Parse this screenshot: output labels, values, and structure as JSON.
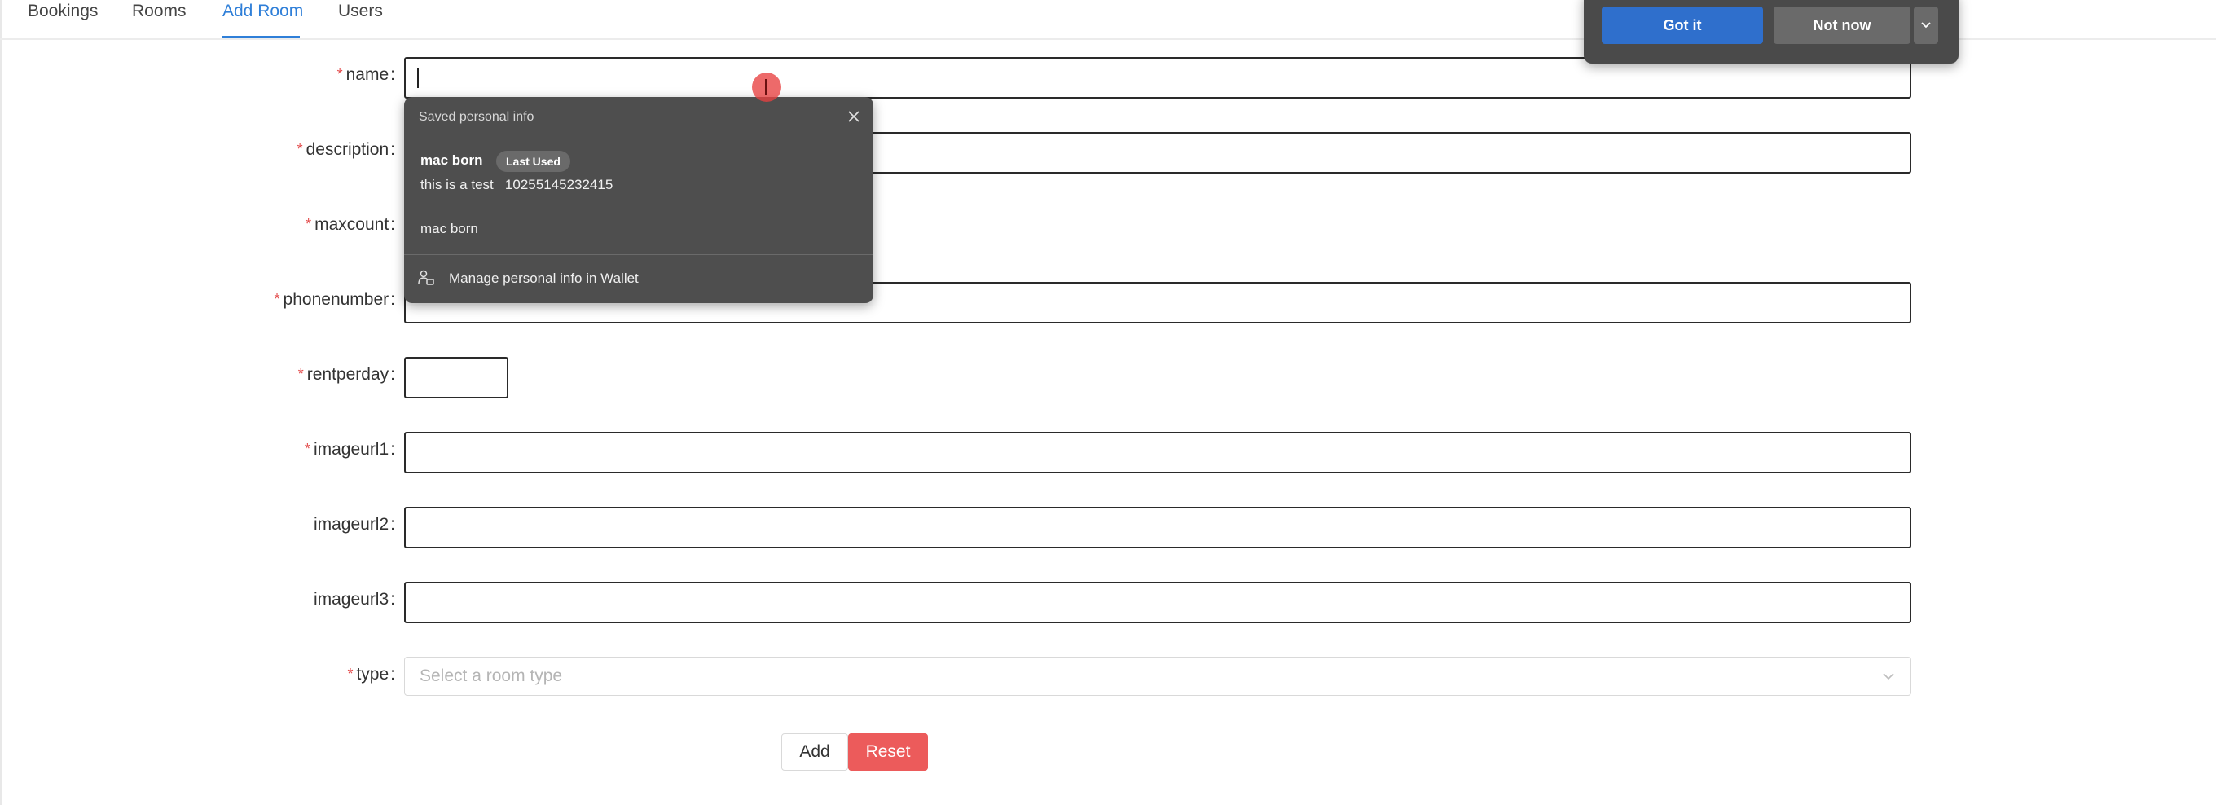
{
  "tabs": [
    {
      "label": "Bookings"
    },
    {
      "label": "Rooms"
    },
    {
      "label": "Add Room",
      "active": true
    },
    {
      "label": "Users"
    }
  ],
  "form": {
    "fields": [
      {
        "label": "name",
        "required": true,
        "value": ""
      },
      {
        "label": "description",
        "required": true,
        "value": ""
      },
      {
        "label": "maxcount",
        "required": true,
        "value": ""
      },
      {
        "label": "phonenumber",
        "required": true,
        "value": ""
      },
      {
        "label": "rentperday",
        "required": true,
        "value": ""
      },
      {
        "label": "imageurl1",
        "required": true,
        "value": ""
      },
      {
        "label": "imageurl2",
        "required": false,
        "value": ""
      },
      {
        "label": "imageurl3",
        "required": false,
        "value": ""
      }
    ],
    "type": {
      "label": "type",
      "required": true,
      "placeholder": "Select a room type"
    },
    "required_mark": "*",
    "colon": ":",
    "add_label": "Add",
    "reset_label": "Reset"
  },
  "autofill_popup": {
    "title": "Saved personal info",
    "entries": [
      {
        "name": "mac born",
        "badge": "Last Used",
        "detail": "this is a test   10255145232415"
      },
      {
        "name": "mac born"
      }
    ],
    "manage_label": "Manage personal info in Wallet"
  },
  "notification": {
    "got_it_label": "Got it",
    "not_now_label": "Not now"
  },
  "colors": {
    "accent": "#2f7fd8",
    "reset": "#ec5b5b",
    "popup_bg": "#4e4e4e",
    "required": "#e34c4c"
  }
}
